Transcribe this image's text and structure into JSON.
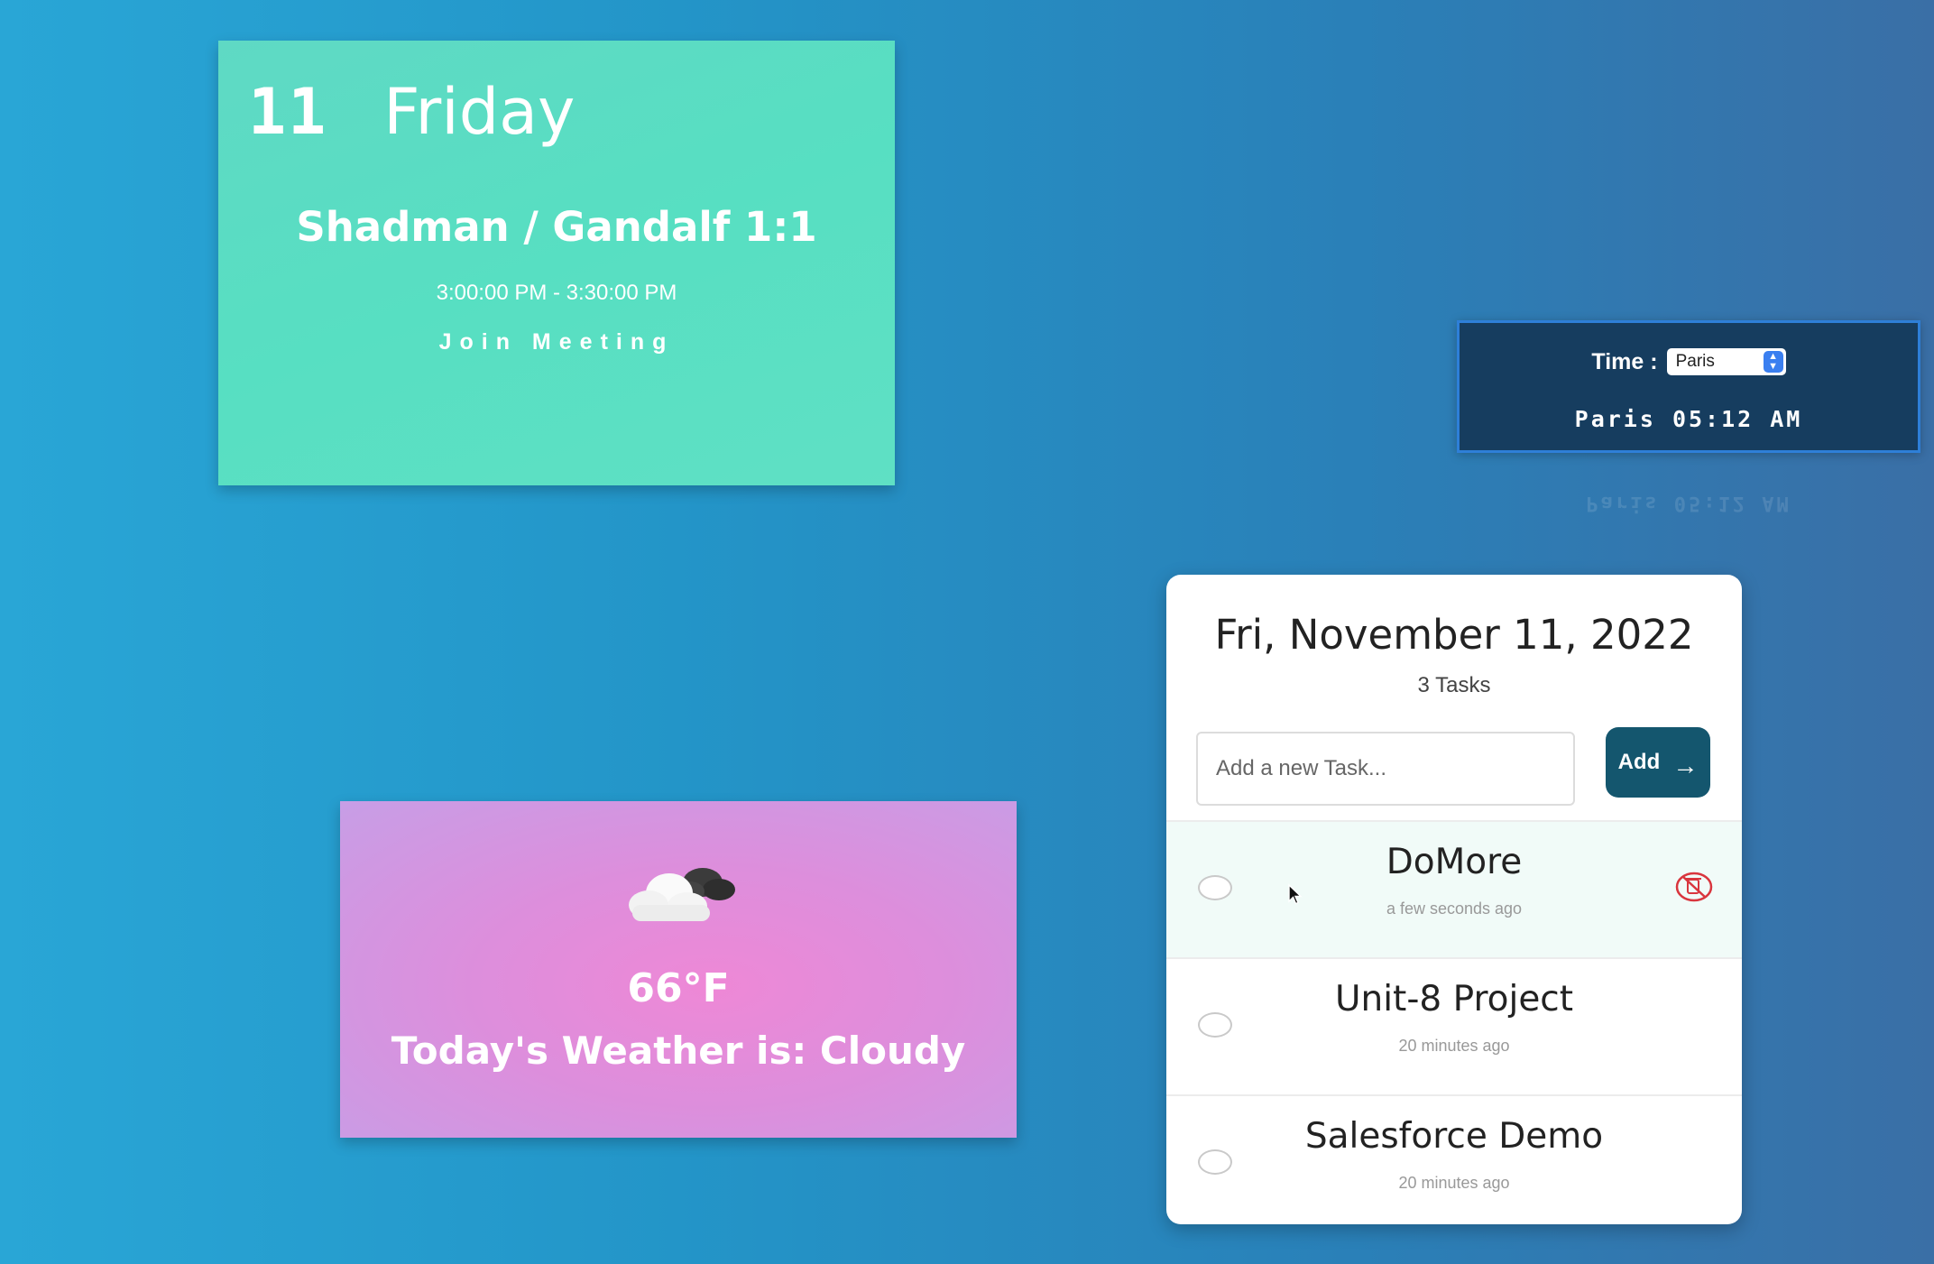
{
  "meeting": {
    "day_number": "11",
    "day_name": "Friday",
    "title": "Shadman / Gandalf 1:1",
    "time_range": "3:00:00 PM - 3:30:00 PM",
    "join_label": "Join Meeting"
  },
  "clock": {
    "label": "Time :",
    "selected_city": "Paris",
    "readout": "Paris 05:12 AM"
  },
  "weather": {
    "icon": "cloudy-icon",
    "temperature": "66°F",
    "description": "Today's Weather is: Cloudy"
  },
  "tasks": {
    "date": "Fri, November 11, 2022",
    "count_label": "3 Tasks",
    "input_placeholder": "Add a new Task...",
    "add_label": "Add",
    "items": [
      {
        "name": "DoMore",
        "time": "a few seconds ago"
      },
      {
        "name": "Unit-8 Project",
        "time": "20 minutes ago"
      },
      {
        "name": "Salesforce Demo",
        "time": "20 minutes ago"
      }
    ]
  },
  "colors": {
    "meeting_card": "#5fd9c4",
    "clock_card": "#163d5f",
    "weather_card": "#ee88d6",
    "add_button": "#14566e",
    "delete_icon": "#d9363e"
  }
}
